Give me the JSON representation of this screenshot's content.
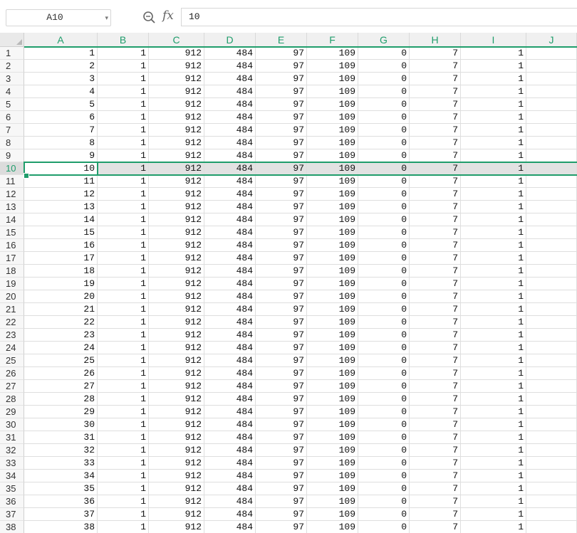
{
  "formula_bar": {
    "name_box": "A10",
    "fx_label": "fx",
    "formula": "10",
    "zoom_icon": "zoom-magnifier-icon",
    "dropdown_icon": "chevron-down-icon"
  },
  "sheet": {
    "accent_color": "#1f9d6b",
    "selected_row": 10,
    "active_cell": "A10",
    "columns": [
      "A",
      "B",
      "C",
      "D",
      "E",
      "F",
      "G",
      "H",
      "I",
      "J"
    ],
    "rows": [
      {
        "n": "1",
        "cells": [
          "1",
          "1",
          "912",
          "484",
          "97",
          "109",
          "0",
          "7",
          "1",
          ""
        ]
      },
      {
        "n": "2",
        "cells": [
          "2",
          "1",
          "912",
          "484",
          "97",
          "109",
          "0",
          "7",
          "1",
          ""
        ]
      },
      {
        "n": "3",
        "cells": [
          "3",
          "1",
          "912",
          "484",
          "97",
          "109",
          "0",
          "7",
          "1",
          ""
        ]
      },
      {
        "n": "4",
        "cells": [
          "4",
          "1",
          "912",
          "484",
          "97",
          "109",
          "0",
          "7",
          "1",
          ""
        ]
      },
      {
        "n": "5",
        "cells": [
          "5",
          "1",
          "912",
          "484",
          "97",
          "109",
          "0",
          "7",
          "1",
          ""
        ]
      },
      {
        "n": "6",
        "cells": [
          "6",
          "1",
          "912",
          "484",
          "97",
          "109",
          "0",
          "7",
          "1",
          ""
        ]
      },
      {
        "n": "7",
        "cells": [
          "7",
          "1",
          "912",
          "484",
          "97",
          "109",
          "0",
          "7",
          "1",
          ""
        ]
      },
      {
        "n": "8",
        "cells": [
          "8",
          "1",
          "912",
          "484",
          "97",
          "109",
          "0",
          "7",
          "1",
          ""
        ]
      },
      {
        "n": "9",
        "cells": [
          "9",
          "1",
          "912",
          "484",
          "97",
          "109",
          "0",
          "7",
          "1",
          ""
        ]
      },
      {
        "n": "10",
        "cells": [
          "10",
          "1",
          "912",
          "484",
          "97",
          "109",
          "0",
          "7",
          "1",
          ""
        ]
      },
      {
        "n": "11",
        "cells": [
          "11",
          "1",
          "912",
          "484",
          "97",
          "109",
          "0",
          "7",
          "1",
          ""
        ]
      },
      {
        "n": "12",
        "cells": [
          "12",
          "1",
          "912",
          "484",
          "97",
          "109",
          "0",
          "7",
          "1",
          ""
        ]
      },
      {
        "n": "13",
        "cells": [
          "13",
          "1",
          "912",
          "484",
          "97",
          "109",
          "0",
          "7",
          "1",
          ""
        ]
      },
      {
        "n": "14",
        "cells": [
          "14",
          "1",
          "912",
          "484",
          "97",
          "109",
          "0",
          "7",
          "1",
          ""
        ]
      },
      {
        "n": "15",
        "cells": [
          "15",
          "1",
          "912",
          "484",
          "97",
          "109",
          "0",
          "7",
          "1",
          ""
        ]
      },
      {
        "n": "16",
        "cells": [
          "16",
          "1",
          "912",
          "484",
          "97",
          "109",
          "0",
          "7",
          "1",
          ""
        ]
      },
      {
        "n": "17",
        "cells": [
          "17",
          "1",
          "912",
          "484",
          "97",
          "109",
          "0",
          "7",
          "1",
          ""
        ]
      },
      {
        "n": "18",
        "cells": [
          "18",
          "1",
          "912",
          "484",
          "97",
          "109",
          "0",
          "7",
          "1",
          ""
        ]
      },
      {
        "n": "19",
        "cells": [
          "19",
          "1",
          "912",
          "484",
          "97",
          "109",
          "0",
          "7",
          "1",
          ""
        ]
      },
      {
        "n": "20",
        "cells": [
          "20",
          "1",
          "912",
          "484",
          "97",
          "109",
          "0",
          "7",
          "1",
          ""
        ]
      },
      {
        "n": "21",
        "cells": [
          "21",
          "1",
          "912",
          "484",
          "97",
          "109",
          "0",
          "7",
          "1",
          ""
        ]
      },
      {
        "n": "22",
        "cells": [
          "22",
          "1",
          "912",
          "484",
          "97",
          "109",
          "0",
          "7",
          "1",
          ""
        ]
      },
      {
        "n": "23",
        "cells": [
          "23",
          "1",
          "912",
          "484",
          "97",
          "109",
          "0",
          "7",
          "1",
          ""
        ]
      },
      {
        "n": "24",
        "cells": [
          "24",
          "1",
          "912",
          "484",
          "97",
          "109",
          "0",
          "7",
          "1",
          ""
        ]
      },
      {
        "n": "25",
        "cells": [
          "25",
          "1",
          "912",
          "484",
          "97",
          "109",
          "0",
          "7",
          "1",
          ""
        ]
      },
      {
        "n": "26",
        "cells": [
          "26",
          "1",
          "912",
          "484",
          "97",
          "109",
          "0",
          "7",
          "1",
          ""
        ]
      },
      {
        "n": "27",
        "cells": [
          "27",
          "1",
          "912",
          "484",
          "97",
          "109",
          "0",
          "7",
          "1",
          ""
        ]
      },
      {
        "n": "28",
        "cells": [
          "28",
          "1",
          "912",
          "484",
          "97",
          "109",
          "0",
          "7",
          "1",
          ""
        ]
      },
      {
        "n": "29",
        "cells": [
          "29",
          "1",
          "912",
          "484",
          "97",
          "109",
          "0",
          "7",
          "1",
          ""
        ]
      },
      {
        "n": "30",
        "cells": [
          "30",
          "1",
          "912",
          "484",
          "97",
          "109",
          "0",
          "7",
          "1",
          ""
        ]
      },
      {
        "n": "31",
        "cells": [
          "31",
          "1",
          "912",
          "484",
          "97",
          "109",
          "0",
          "7",
          "1",
          ""
        ]
      },
      {
        "n": "32",
        "cells": [
          "32",
          "1",
          "912",
          "484",
          "97",
          "109",
          "0",
          "7",
          "1",
          ""
        ]
      },
      {
        "n": "33",
        "cells": [
          "33",
          "1",
          "912",
          "484",
          "97",
          "109",
          "0",
          "7",
          "1",
          ""
        ]
      },
      {
        "n": "34",
        "cells": [
          "34",
          "1",
          "912",
          "484",
          "97",
          "109",
          "0",
          "7",
          "1",
          ""
        ]
      },
      {
        "n": "35",
        "cells": [
          "35",
          "1",
          "912",
          "484",
          "97",
          "109",
          "0",
          "7",
          "1",
          ""
        ]
      },
      {
        "n": "36",
        "cells": [
          "36",
          "1",
          "912",
          "484",
          "97",
          "109",
          "0",
          "7",
          "1",
          ""
        ]
      },
      {
        "n": "37",
        "cells": [
          "37",
          "1",
          "912",
          "484",
          "97",
          "109",
          "0",
          "7",
          "1",
          ""
        ]
      },
      {
        "n": "38",
        "cells": [
          "38",
          "1",
          "912",
          "484",
          "97",
          "109",
          "0",
          "7",
          "1",
          ""
        ]
      }
    ]
  }
}
